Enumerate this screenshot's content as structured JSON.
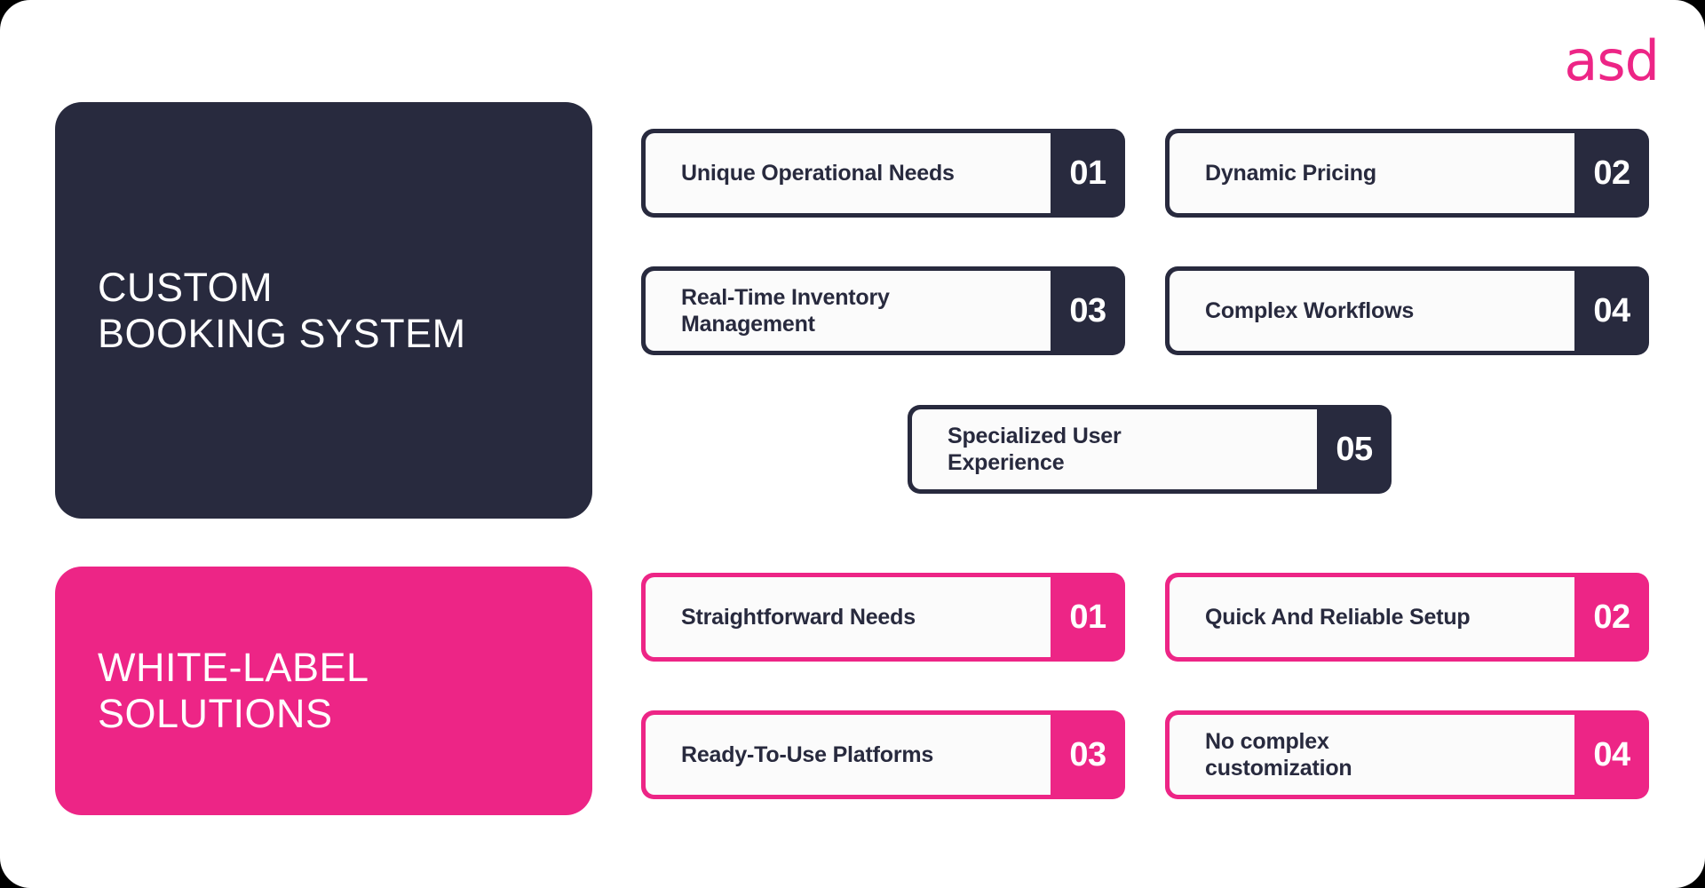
{
  "brand": {
    "logo_text": "asd",
    "accent_pink": "#ED2586",
    "accent_dark": "#282A3E",
    "panel_white": "#FBFBFB"
  },
  "sections": [
    {
      "id": "custom-booking-system",
      "title": "CUSTOM\nBOOKING SYSTEM",
      "theme": "dark",
      "items": [
        {
          "number": "01",
          "label": "Unique Operational Needs"
        },
        {
          "number": "02",
          "label": "Dynamic Pricing"
        },
        {
          "number": "03",
          "label": "Real-Time Inventory\nManagement"
        },
        {
          "number": "04",
          "label": "Complex Workflows"
        },
        {
          "number": "05",
          "label": "Specialized User\nExperience"
        }
      ]
    },
    {
      "id": "white-label-solutions",
      "title": "WHITE-LABEL\nSOLUTIONS",
      "theme": "pink",
      "items": [
        {
          "number": "01",
          "label": "Straightforward Needs"
        },
        {
          "number": "02",
          "label": "Quick And Reliable Setup"
        },
        {
          "number": "03",
          "label": "Ready-To-Use Platforms"
        },
        {
          "number": "04",
          "label": "No complex\ncustomization"
        }
      ]
    }
  ]
}
